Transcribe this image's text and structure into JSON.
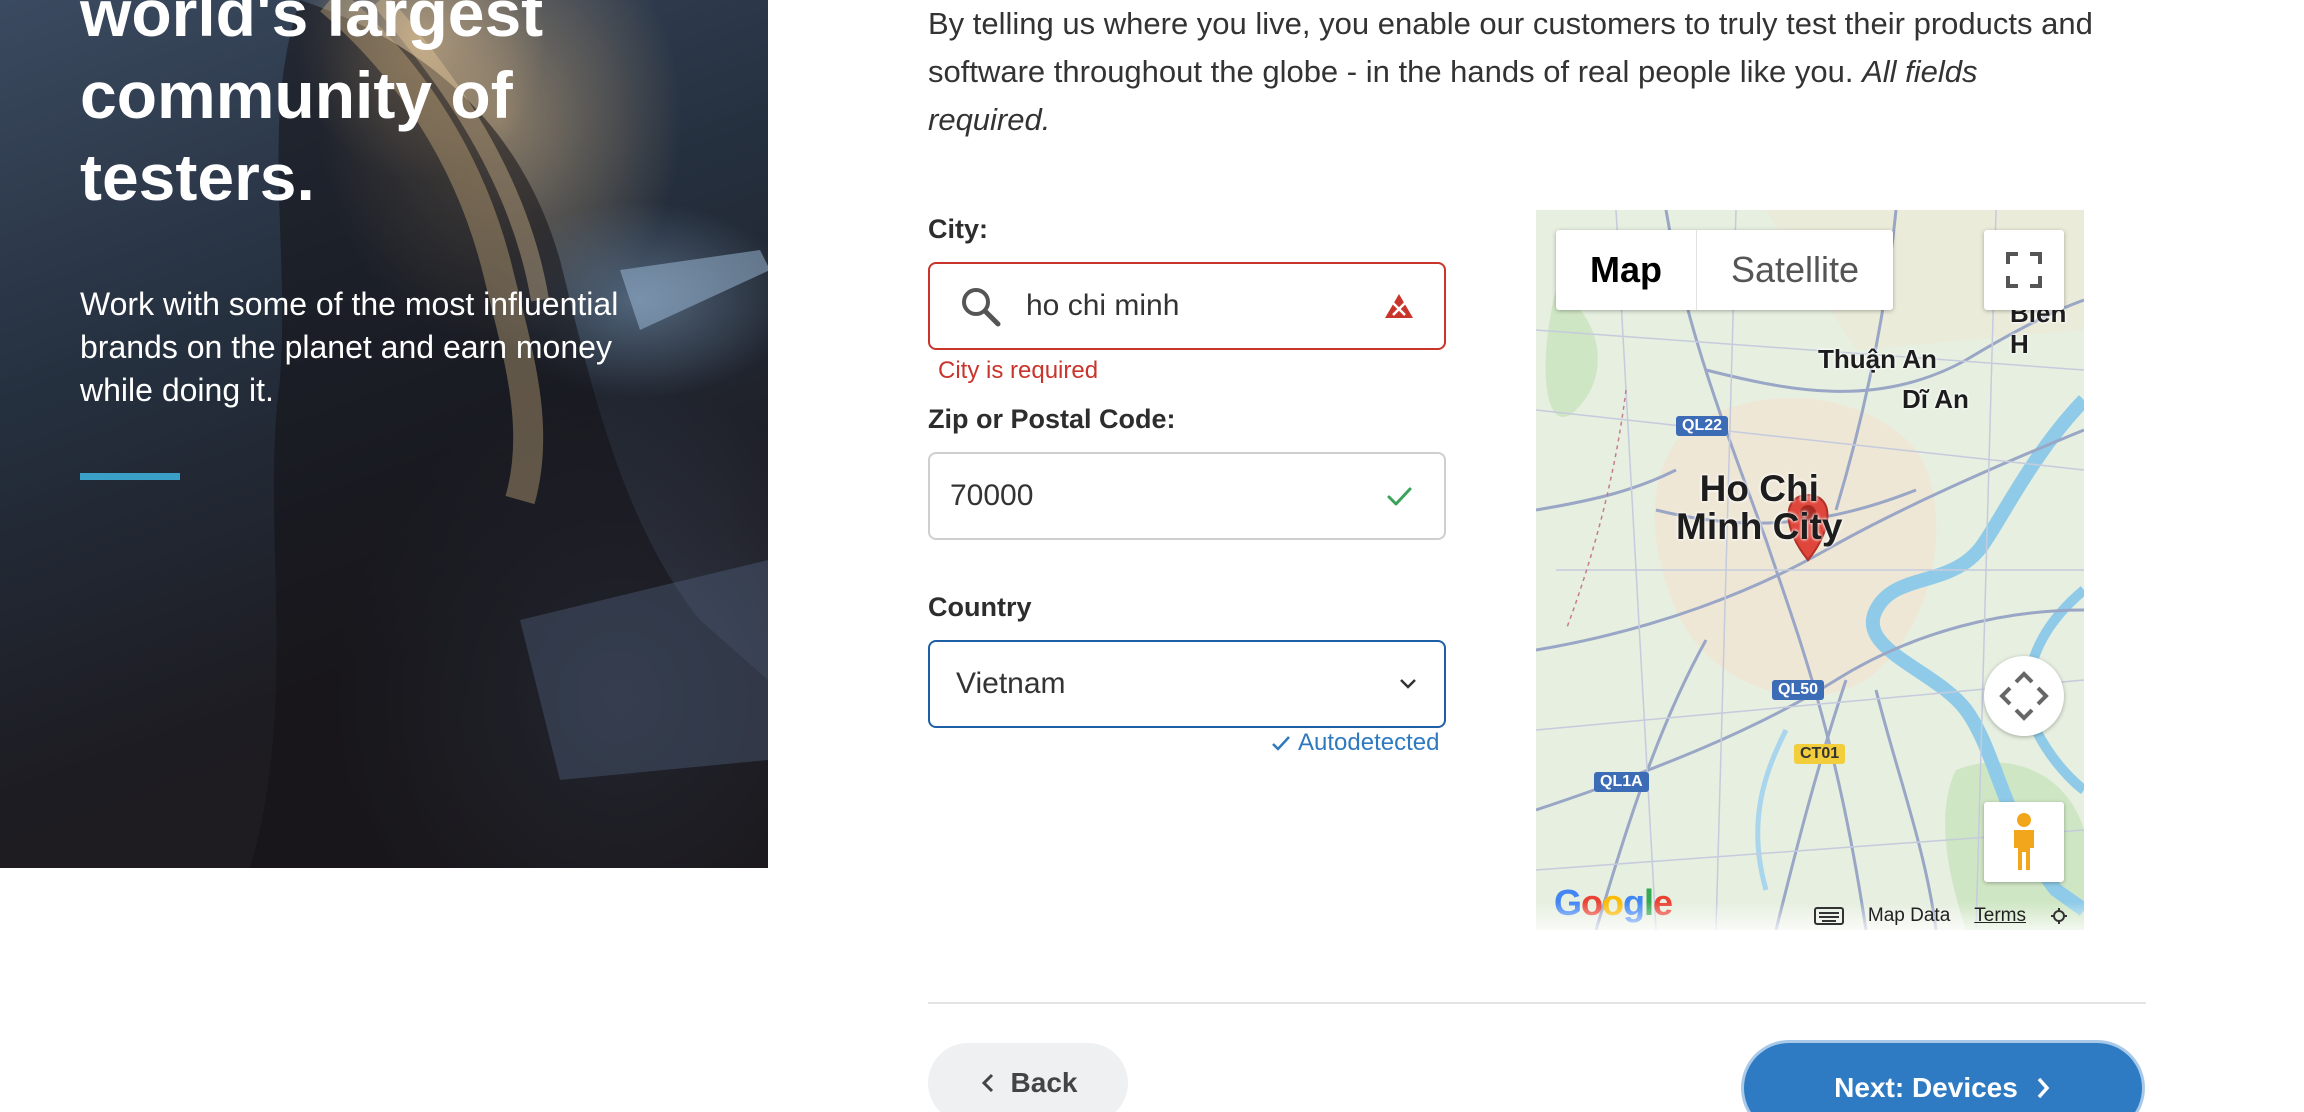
{
  "hero": {
    "title": "world's largest\ncommunity of\ntesters.",
    "subtitle": "Work with some of the most influential brands on the planet and earn money while doing it."
  },
  "intro": {
    "text": "By telling us where you live, you enable our customers to truly test their products and software throughout the globe - in the hands of real people like you.",
    "emphasis": "All fields required."
  },
  "form": {
    "city": {
      "label": "City:",
      "value": "ho chi minh",
      "error": "City is required"
    },
    "zip": {
      "label": "Zip or Postal Code:",
      "value": "70000"
    },
    "country": {
      "label": "Country",
      "value": "Vietnam",
      "note": "Autodetected"
    }
  },
  "map": {
    "tabs": [
      "Map",
      "Satellite"
    ],
    "active_tab": "Map",
    "city_label": "Ho Chi\nMinh City",
    "district_labels": [
      "Thuận An",
      "Dĩ An",
      "Biên H"
    ],
    "road_shields": [
      "QL22",
      "QL50",
      "CT01",
      "QL1A"
    ],
    "footer": {
      "map_data": "Map Data",
      "terms": "Terms"
    },
    "logo_text": "Google"
  },
  "nav": {
    "back": "Back",
    "next": "Next: Devices"
  },
  "colors": {
    "accent": "#2f7bc3",
    "error": "#c9352b",
    "success": "#3aa35a",
    "hero_rule": "#3aa0c8"
  }
}
